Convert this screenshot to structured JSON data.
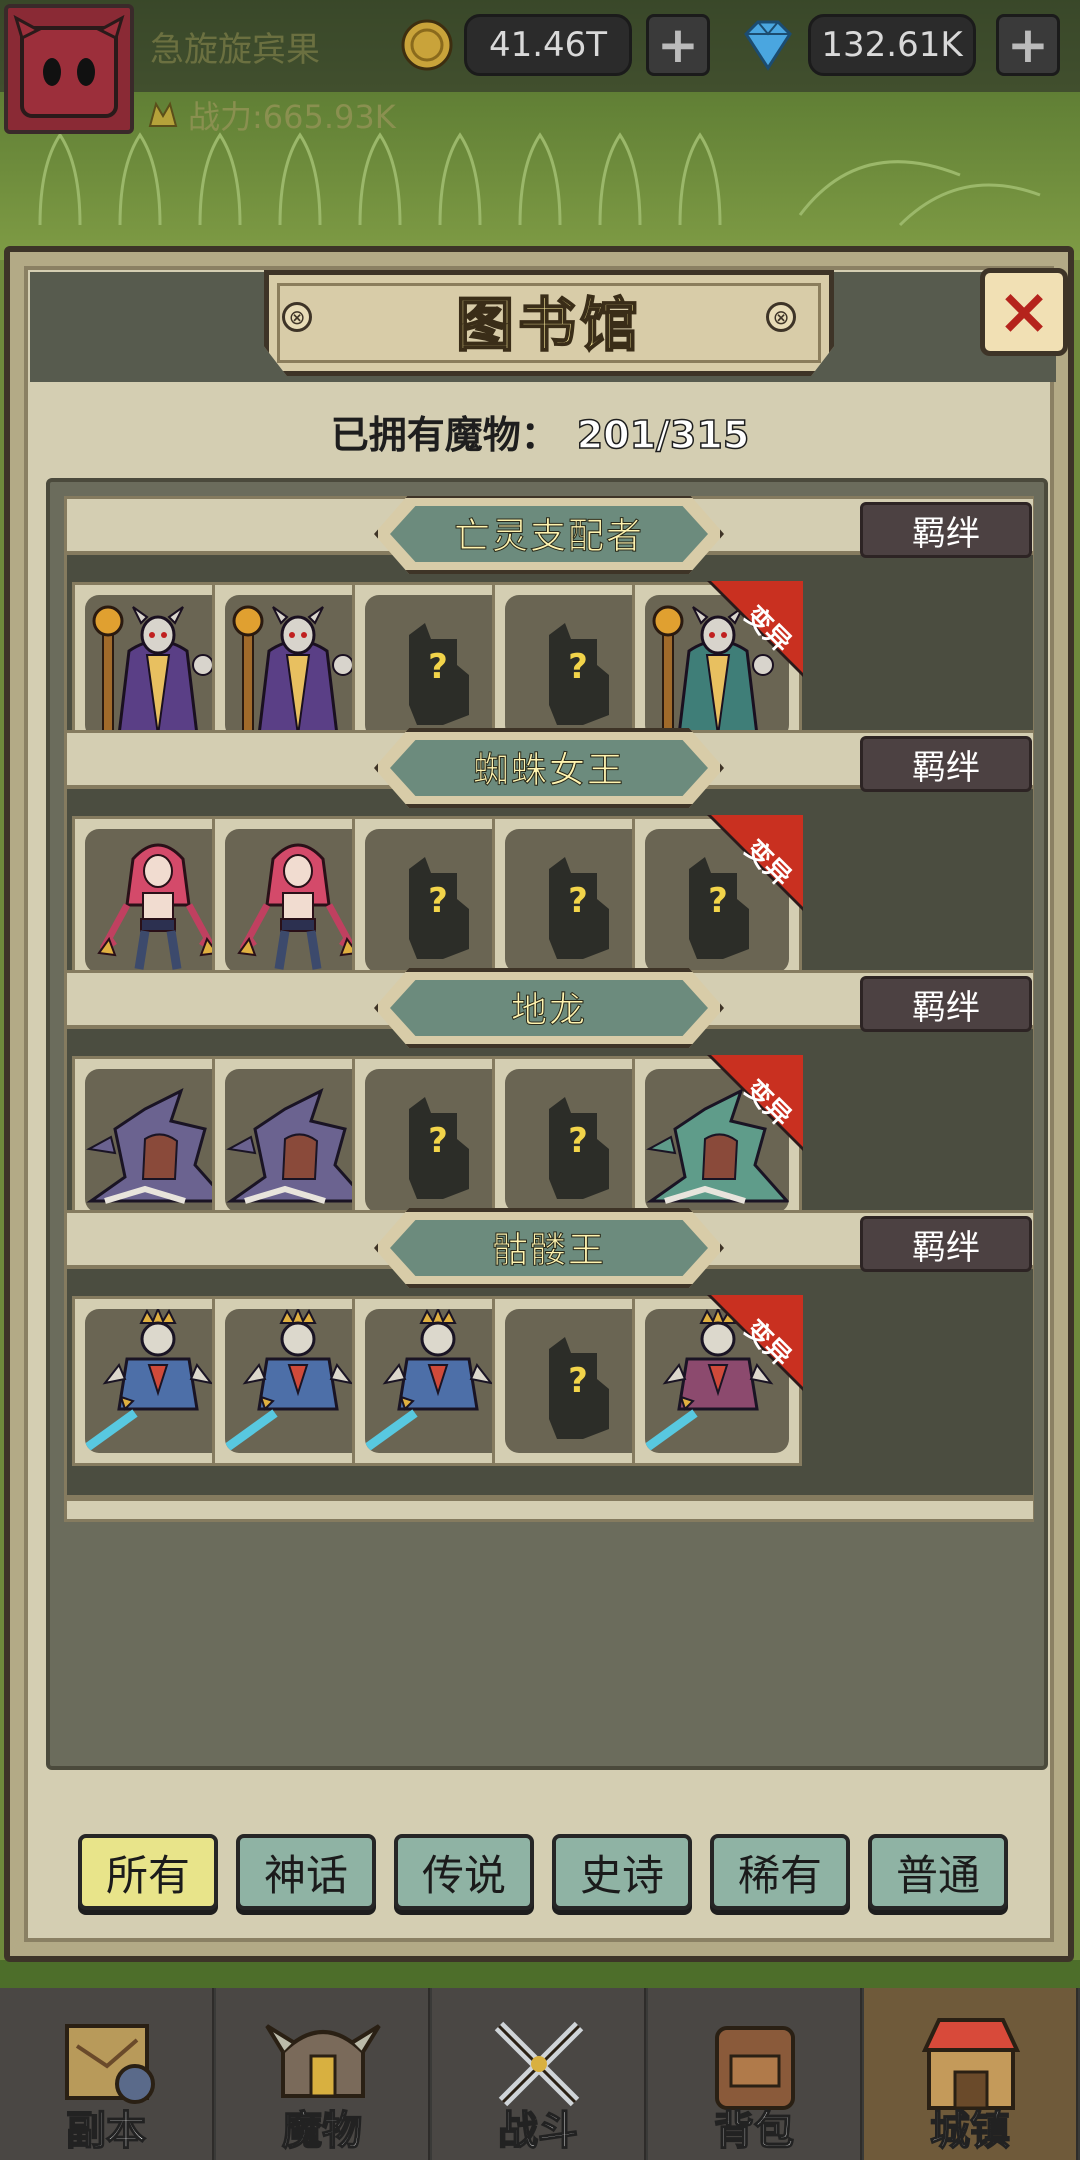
{
  "top_bar": {
    "player_name": "急旋旋宾果",
    "gold": "41.46T",
    "gems": "132.61K",
    "power": "战力:665.93K"
  },
  "modal": {
    "title": "图书馆",
    "owned_label": "已拥有魔物：",
    "owned_value": "201/315",
    "close_icon": "×"
  },
  "groups": [
    {
      "name": "亡灵支配者",
      "bond": "羁绊",
      "slots": [
        {
          "state": "owned",
          "creature": "lich"
        },
        {
          "state": "owned",
          "creature": "lich"
        },
        {
          "state": "unknown",
          "mark": "?"
        },
        {
          "state": "unknown",
          "mark": "?"
        },
        {
          "state": "owned",
          "creature": "lich",
          "variant": "mutant",
          "badge": "变异"
        }
      ]
    },
    {
      "name": "蜘蛛女王",
      "bond": "羁绊",
      "slots": [
        {
          "state": "owned",
          "creature": "spider-queen"
        },
        {
          "state": "owned",
          "creature": "spider-queen"
        },
        {
          "state": "unknown",
          "mark": "?"
        },
        {
          "state": "unknown",
          "mark": "?"
        },
        {
          "state": "unknown",
          "mark": "?",
          "badge": "变异"
        }
      ]
    },
    {
      "name": "地龙",
      "bond": "羁绊",
      "slots": [
        {
          "state": "owned",
          "creature": "earth-dragon"
        },
        {
          "state": "owned",
          "creature": "earth-dragon"
        },
        {
          "state": "unknown",
          "mark": "?"
        },
        {
          "state": "unknown",
          "mark": "?"
        },
        {
          "state": "owned",
          "creature": "earth-dragon",
          "variant": "mutant",
          "badge": "变异"
        }
      ]
    },
    {
      "name": "骷髅王",
      "bond": "羁绊",
      "slots": [
        {
          "state": "owned",
          "creature": "skeleton-king"
        },
        {
          "state": "owned",
          "creature": "skeleton-king"
        },
        {
          "state": "owned",
          "creature": "skeleton-king"
        },
        {
          "state": "unknown",
          "mark": "?"
        },
        {
          "state": "owned",
          "creature": "skeleton-king",
          "variant": "mutant",
          "badge": "变异"
        }
      ]
    }
  ],
  "filters": [
    "所有",
    "神话",
    "传说",
    "史诗",
    "稀有",
    "普通"
  ],
  "active_filter": "所有",
  "nav": [
    {
      "label": "副本",
      "icon": "map-icon"
    },
    {
      "label": "魔物",
      "icon": "monster-helmet-icon"
    },
    {
      "label": "战斗",
      "icon": "crossed-swords-icon"
    },
    {
      "label": "背包",
      "icon": "backpack-icon"
    },
    {
      "label": "城镇",
      "icon": "town-shop-icon"
    }
  ],
  "active_nav": "城镇",
  "colors": {
    "panel_bg": "#d4ceb2",
    "dark_slot_bg": "#4b4d40",
    "plate_teal": "#6c8b7d",
    "title_yellow": "#fff1a0",
    "mutant_badge_red": "#c93020",
    "filter_teal": "#8fb3a4",
    "filter_active": "#e8e48a"
  }
}
